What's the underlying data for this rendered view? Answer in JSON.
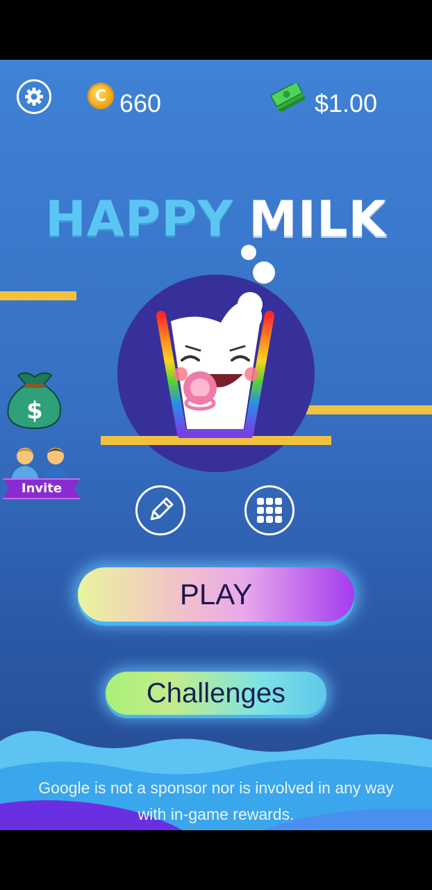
{
  "topbar": {
    "settings_icon": "gear-icon",
    "coin_icon": "coin-icon",
    "coin_symbol": "C",
    "coins": "660",
    "cash_icon": "cash-stack-icon",
    "cash": "$1.00"
  },
  "title": {
    "word1": "HAPPY",
    "word2": "MILK"
  },
  "side": {
    "bag_icon": "money-bag-icon",
    "invite_icon": "invite-friends-icon",
    "invite_label": "Invite"
  },
  "buttons": {
    "edit_icon": "pencil-icon",
    "levels_icon": "grid-icon",
    "play": "PLAY",
    "challenges": "Challenges"
  },
  "footer": {
    "line1": "Google is not a sponsor nor is involved in any way",
    "line2": "with in-game rewards."
  },
  "colors": {
    "background_top": "#3f82d6",
    "title_happy": "#5bc6f4",
    "title_milk": "#ffffff",
    "platform": "#f2c23f",
    "logo_circle": "#37309a"
  }
}
